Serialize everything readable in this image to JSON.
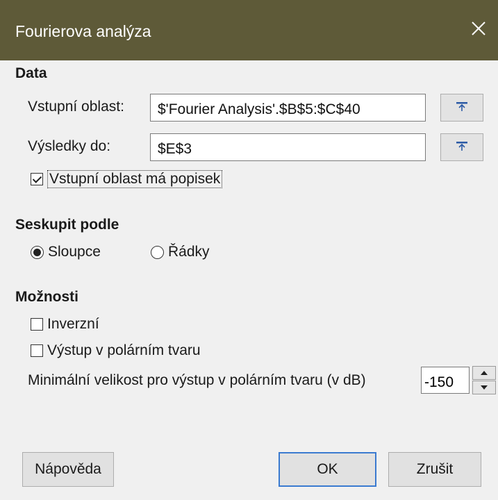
{
  "window": {
    "title": "Fourierova analýza",
    "close_glyph": "✕"
  },
  "data_section": {
    "title": "Data",
    "input_range": {
      "label": "Vstupní oblast:",
      "value": "$'Fourier Analysis'.$B$5:$C$40"
    },
    "results_to": {
      "label": "Výsledky do:",
      "value": "$E$3"
    },
    "has_label_checkbox": {
      "label": "Vstupní oblast má popisek",
      "checked": true
    }
  },
  "group_section": {
    "title": "Seskupit podle",
    "options": [
      {
        "label": "Sloupce",
        "selected": true
      },
      {
        "label": "Řádky",
        "selected": false
      }
    ]
  },
  "options_section": {
    "title": "Možnosti",
    "inverse": {
      "label": "Inverzní",
      "checked": false
    },
    "polar_output": {
      "label": "Výstup v polárním tvaru",
      "checked": false
    },
    "min_magnitude": {
      "label": "Minimální velikost pro výstup v polárním tvaru (v dB)",
      "value": "-150"
    }
  },
  "buttons": {
    "help": "Nápověda",
    "ok": "OK",
    "cancel": "Zrušit"
  },
  "colors": {
    "titlebar": "#5e5a38",
    "background": "#f0f0f0",
    "default_button_border": "#3a7ad0"
  }
}
